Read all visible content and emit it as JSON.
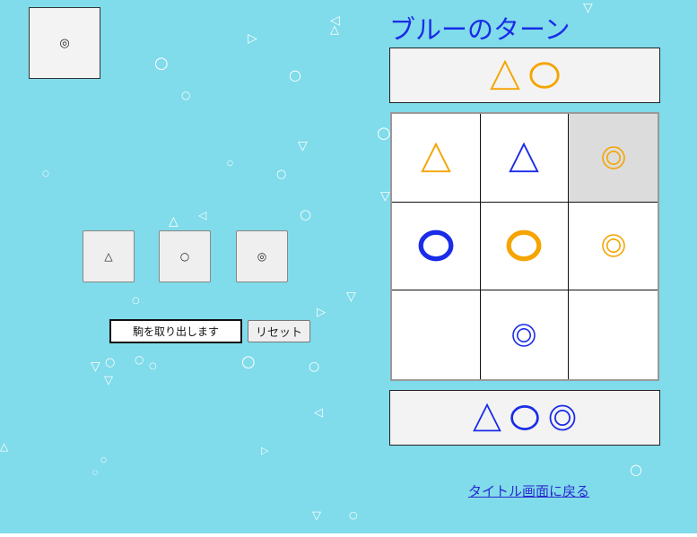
{
  "colors": {
    "background": "#80dbea",
    "blue": "#1a2ce8",
    "orange": "#f5a400",
    "panel": "#f3f3f3",
    "highlight": "#dcdcdc"
  },
  "preview": {
    "symbol": "◎"
  },
  "picker": [
    {
      "symbol": "△",
      "kind": "small"
    },
    {
      "symbol": "○",
      "kind": "medium"
    },
    {
      "symbol": "◎",
      "kind": "large"
    }
  ],
  "controls": {
    "status_value": "駒を取り出します",
    "reset_label": "リセット"
  },
  "turn_title": "ブルーのターン",
  "orange_hand": [
    {
      "kind": "small",
      "color": "orange"
    },
    {
      "kind": "medium",
      "color": "orange"
    }
  ],
  "board": [
    {
      "kind": "small",
      "color": "orange",
      "highlight": false
    },
    {
      "kind": "small",
      "color": "blue",
      "highlight": false
    },
    {
      "kind": "large",
      "color": "orange",
      "highlight": true
    },
    {
      "kind": "medium",
      "color": "blue",
      "highlight": false
    },
    {
      "kind": "medium",
      "color": "orange",
      "highlight": false
    },
    {
      "kind": "large",
      "color": "orange",
      "highlight": false
    },
    {
      "kind": "empty",
      "color": "",
      "highlight": false
    },
    {
      "kind": "large",
      "color": "blue",
      "highlight": false
    },
    {
      "kind": "empty",
      "color": "",
      "highlight": false
    }
  ],
  "blue_hand": [
    {
      "kind": "small",
      "color": "blue"
    },
    {
      "kind": "medium",
      "color": "blue"
    },
    {
      "kind": "large",
      "color": "blue"
    }
  ],
  "back_link": "タイトル画面に戻る"
}
